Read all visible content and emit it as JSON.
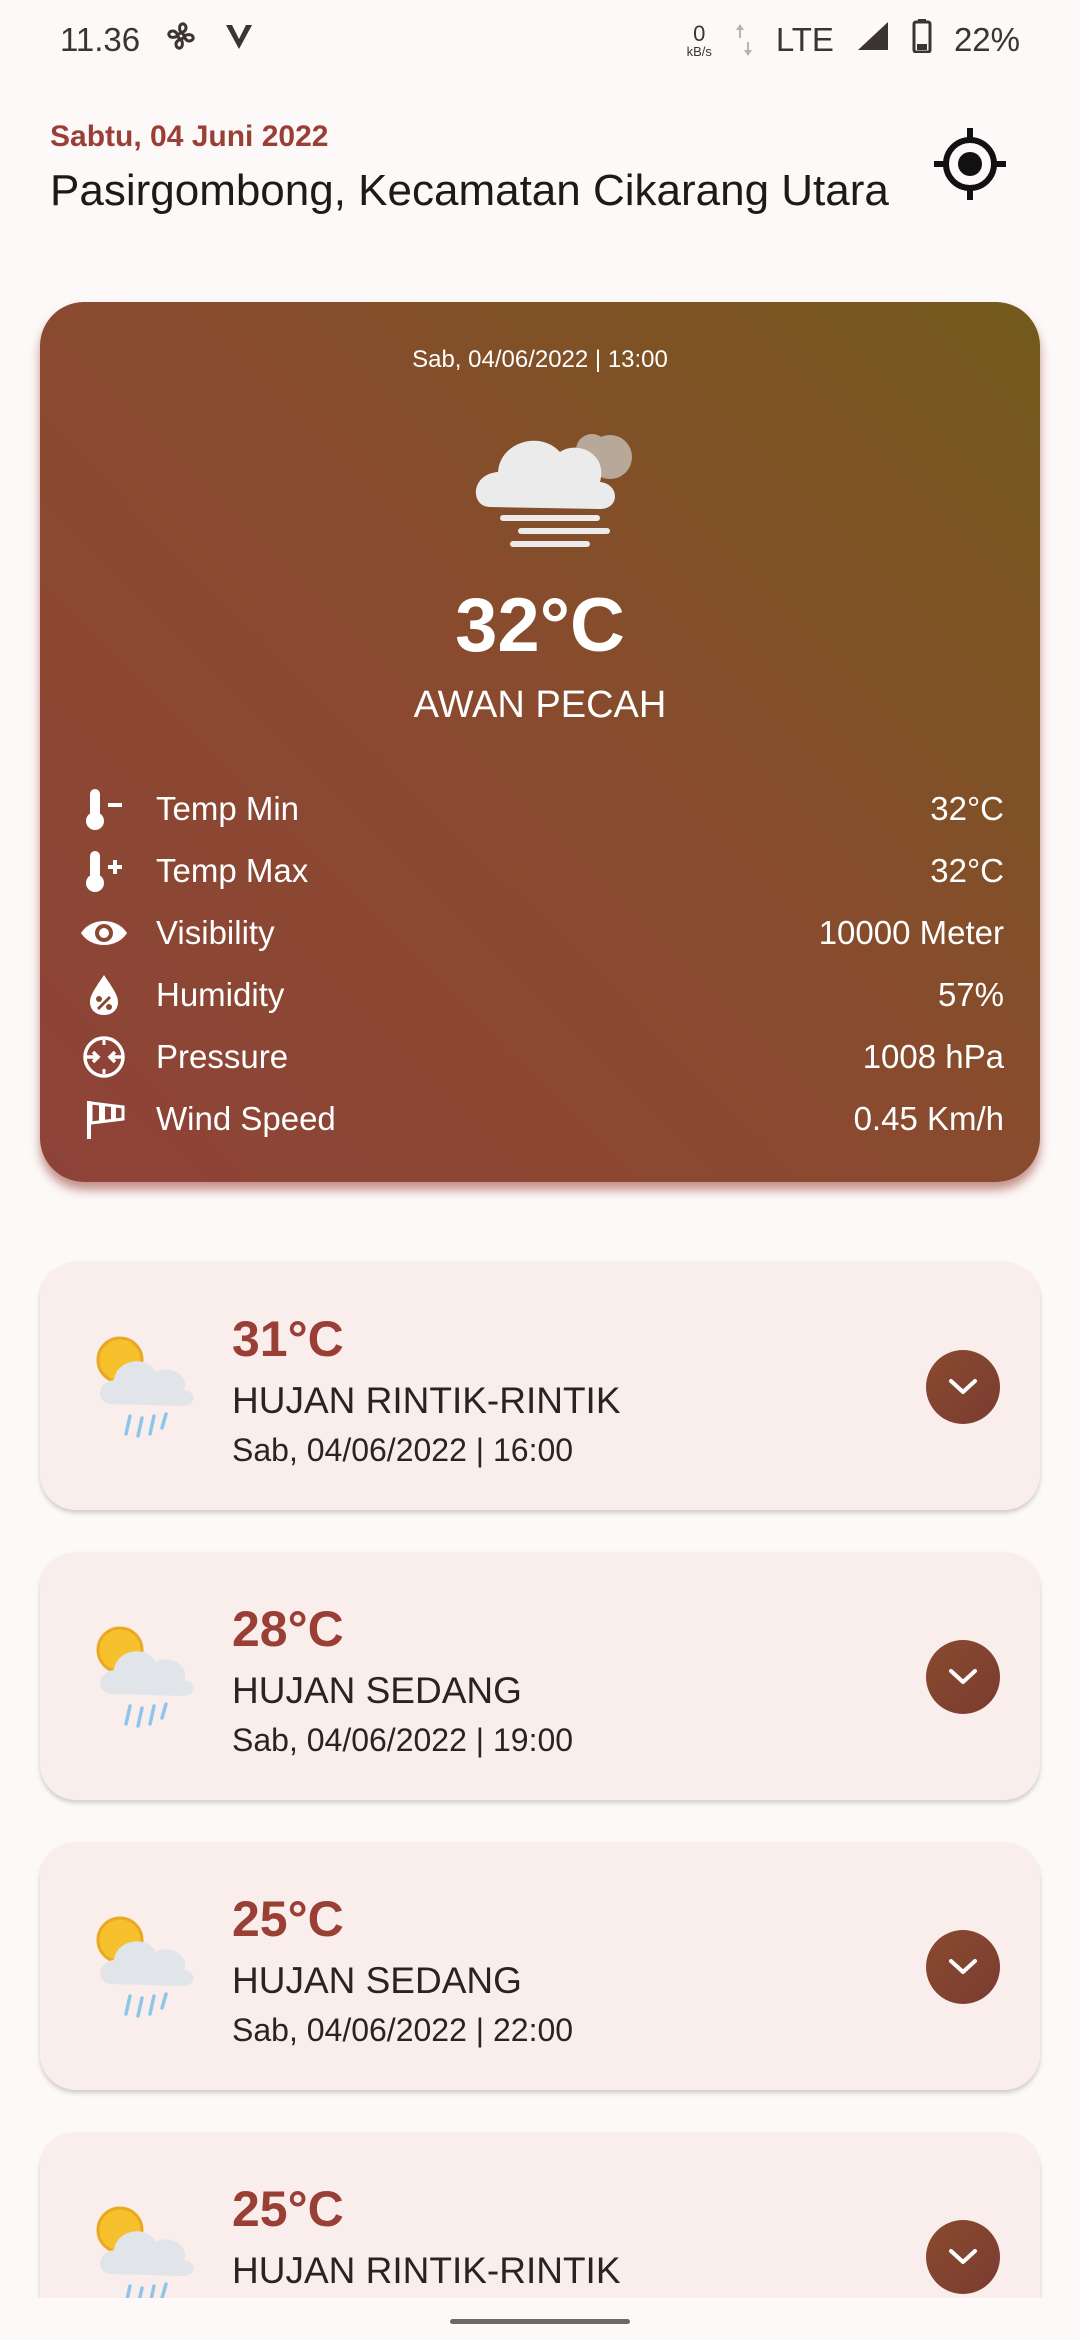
{
  "status_bar": {
    "time": "11.36",
    "net_rate_value": "0",
    "net_rate_unit": "kB/s",
    "network": "LTE",
    "battery": "22%"
  },
  "header": {
    "date": "Sabtu, 04 Juni 2022",
    "location": "Pasirgombong, Kecamatan Cikarang Utara"
  },
  "current": {
    "datetime": "Sab, 04/06/2022 | 13:00",
    "temperature": "32°C",
    "description": "AWAN PECAH",
    "details": [
      {
        "icon": "thermometer-minus-icon",
        "label": "Temp Min",
        "value": "32°C"
      },
      {
        "icon": "thermometer-plus-icon",
        "label": "Temp Max",
        "value": "32°C"
      },
      {
        "icon": "eye-icon",
        "label": "Visibility",
        "value": "10000 Meter"
      },
      {
        "icon": "humidity-icon",
        "label": "Humidity",
        "value": "57%"
      },
      {
        "icon": "pressure-icon",
        "label": "Pressure",
        "value": "1008 hPa"
      },
      {
        "icon": "windsock-icon",
        "label": "Wind Speed",
        "value": "0.45 Km/h"
      }
    ]
  },
  "forecast": [
    {
      "temperature": "31°C",
      "description": "HUJAN RINTIK-RINTIK",
      "datetime": "Sab, 04/06/2022 | 16:00"
    },
    {
      "temperature": "28°C",
      "description": "HUJAN SEDANG",
      "datetime": "Sab, 04/06/2022 | 19:00"
    },
    {
      "temperature": "25°C",
      "description": "HUJAN SEDANG",
      "datetime": "Sab, 04/06/2022 | 22:00"
    },
    {
      "temperature": "25°C",
      "description": "HUJAN RINTIK-RINTIK",
      "datetime": ""
    }
  ],
  "colors": {
    "accent": "#9a3f36",
    "card_gradient_start": "#8e4338",
    "card_gradient_end": "#735a1b",
    "forecast_card_bg": "#faeeec"
  }
}
